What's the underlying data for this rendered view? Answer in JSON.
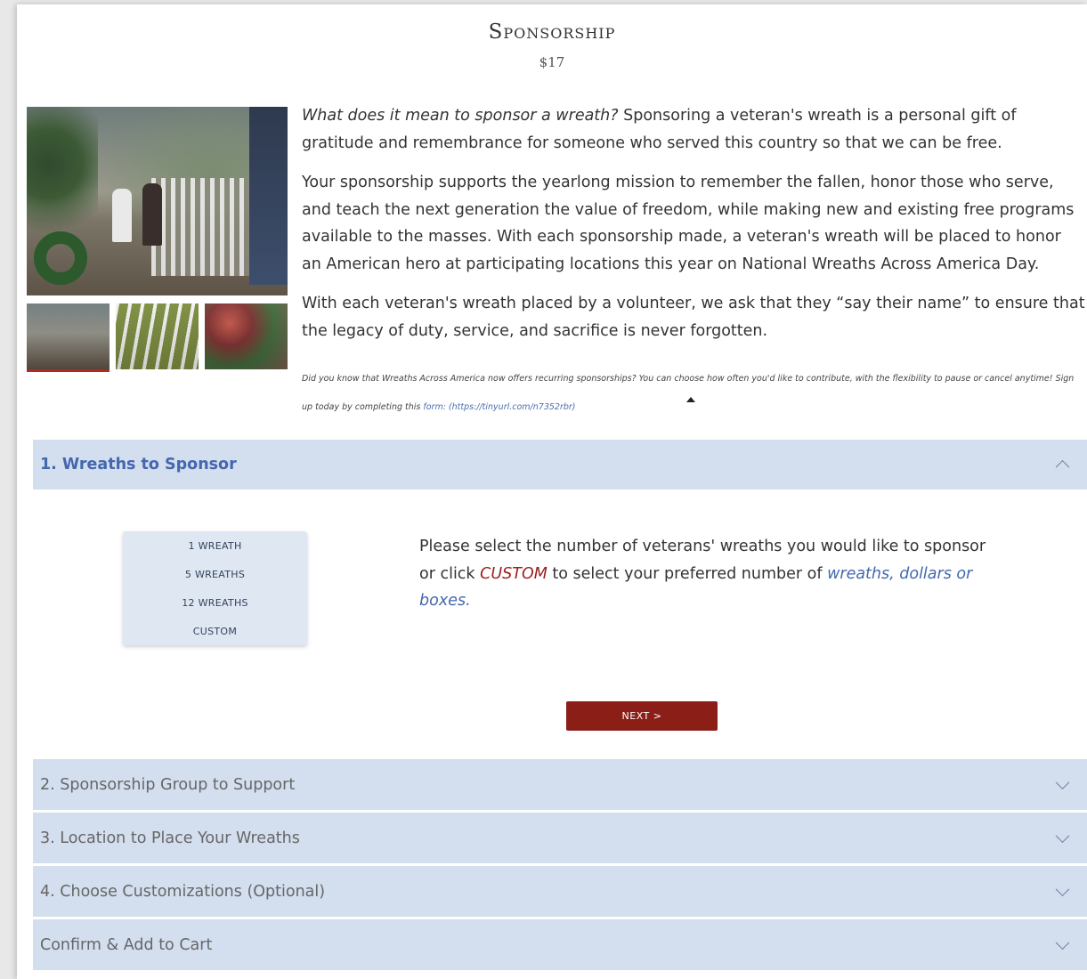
{
  "product": {
    "title": "Sponsorship",
    "price": "$17"
  },
  "gallery": {
    "main_image": "cemetery-volunteers-wreaths-photo",
    "thumbnails": [
      "thumb-volunteers-walking",
      "thumb-wreath-placing",
      "thumb-group-with-wreaths"
    ]
  },
  "description": {
    "p1_lead": "What does it mean to sponsor a wreath?",
    "p1_rest": " Sponsoring a veteran's wreath is a personal gift of gratitude and remembrance for someone who served this country so that we can be free.",
    "p2": "Your sponsorship supports the yearlong mission to remember the fallen, honor those who serve, and teach the next generation the value of freedom, while making new and existing free programs available to the masses. With each sponsorship made, a veteran's wreath will be placed to honor an American hero at participating locations this year on National Wreaths Across America Day.",
    "p3": "With each veteran's wreath placed by a volunteer, we ask that they “say their name” to ensure that the legacy of duty, service, and sacrifice is never forgotten.",
    "note": "Did you know that Wreaths Across America now offers recurring sponsorships? You can choose how often you'd like to contribute, with the flexibility to pause or cancel anytime! Sign up today by completing this ",
    "note_link": "form: (https://tinyurl.com/n7352rbr)"
  },
  "accordion": {
    "step1": "1. Wreaths to Sponsor",
    "step2": "2. Sponsorship Group to Support",
    "step3": "3. Location to Place Your Wreaths",
    "step4": "4. Choose Customizations (Optional)",
    "step5": "Confirm & Add to Cart"
  },
  "quantity_options": [
    "1 WREATH",
    "5 WREATHS",
    "12 WREATHS",
    "CUSTOM"
  ],
  "instructions": {
    "part1": "Please select the number of veterans' wreaths you would like to sponsor or click ",
    "custom": "CUSTOM",
    "part2": " to select your preferred number of ",
    "blue": "wreaths, dollars or boxes",
    "end": "."
  },
  "next_button": "NEXT >",
  "colors": {
    "accordion_bg": "#d3deef",
    "active_label": "#4467ad",
    "next_button_bg": "#8b1f18",
    "custom_text": "#9b1c1c"
  }
}
